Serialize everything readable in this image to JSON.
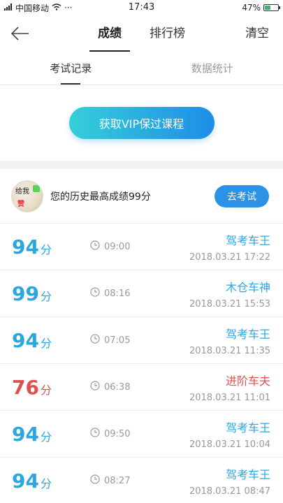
{
  "status_bar": {
    "carrier": "中国移动",
    "dots": "···",
    "time": "17:43",
    "battery": "47%",
    "battery_level": 0.47
  },
  "nav": {
    "tabs": [
      "成绩",
      "排行榜"
    ],
    "active_tab": 0,
    "clear_label": "清空"
  },
  "sub_tabs": {
    "items": [
      "考试记录",
      "数据统计"
    ],
    "active": 0
  },
  "vip": {
    "button_label": "获取VIP保过课程"
  },
  "best": {
    "avatar_text_top": "给我",
    "avatar_text_bottom": "赞",
    "text": "您的历史最高成绩99分",
    "button_label": "去考试"
  },
  "records": [
    {
      "score": "94",
      "unit": "分",
      "duration": "09:00",
      "title": "驾考车王",
      "date": "2018.03.21  17:22",
      "color": "#2aa6e0"
    },
    {
      "score": "99",
      "unit": "分",
      "duration": "08:16",
      "title": "木仓车神",
      "date": "2018.03.21  15:53",
      "color": "#2aa6e0"
    },
    {
      "score": "94",
      "unit": "分",
      "duration": "07:05",
      "title": "驾考车王",
      "date": "2018.03.21  11:35",
      "color": "#2aa6e0"
    },
    {
      "score": "76",
      "unit": "分",
      "duration": "06:38",
      "title": "进阶车夫",
      "date": "2018.03.21  11:01",
      "color": "#e05050"
    },
    {
      "score": "94",
      "unit": "分",
      "duration": "09:50",
      "title": "驾考车王",
      "date": "2018.03.21  10:04",
      "color": "#2aa6e0"
    },
    {
      "score": "94",
      "unit": "分",
      "duration": "08:27",
      "title": "驾考车王",
      "date": "2018.03.21  08:47",
      "color": "#2aa6e0"
    }
  ]
}
